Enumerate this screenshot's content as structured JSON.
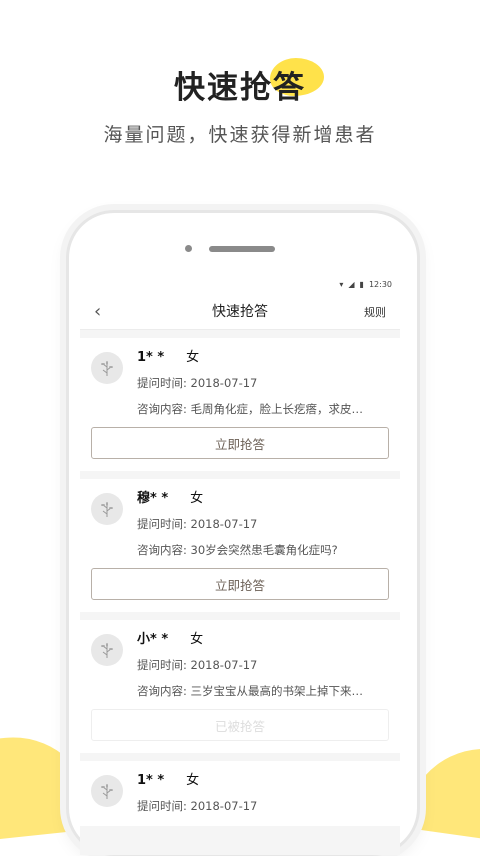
{
  "hero": {
    "title": "快速抢答",
    "subtitle": "海量问题，快速获得新增患者"
  },
  "phone_screen": {
    "status_time": "12:30",
    "nav": {
      "title": "快速抢答",
      "rule_label": "规则"
    },
    "cards": [
      {
        "name": "1* *",
        "gender": "女",
        "time": "提问时间: 2018-07-17",
        "content": "咨询内容: 毛周角化症，脸上长疙瘩，求皮…",
        "button": "立即抢答",
        "disabled": false
      },
      {
        "name": "穆* *",
        "gender": "女",
        "time": "提问时间: 2018-07-17",
        "content": "咨询内容: 30岁会突然患毛囊角化症吗?",
        "button": "立即抢答",
        "disabled": false
      },
      {
        "name": "小* *",
        "gender": "女",
        "time": "提问时间: 2018-07-17",
        "content": "咨询内容: 三岁宝宝从最高的书架上掉下来…",
        "button": "已被抢答",
        "disabled": true
      },
      {
        "name": "1* *",
        "gender": "女",
        "time": "提问时间: 2018-07-17",
        "content": "",
        "button": "",
        "disabled": false
      }
    ]
  },
  "colors": {
    "accent_yellow": "#ffe24a",
    "button_border": "#b8b0a8",
    "button_text": "#6b5f55"
  }
}
